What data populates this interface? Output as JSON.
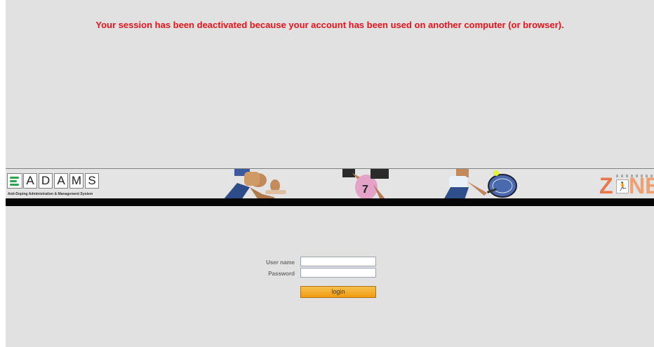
{
  "alert": {
    "message": "Your session has been deactivated because your account has been used on another computer (or browser)."
  },
  "banner": {
    "logo": {
      "letters": [
        "A",
        "D",
        "A",
        "M",
        "S"
      ],
      "tagline": "Anti-Doping Administration & Management System"
    },
    "zone_logo": "ZONE",
    "athlete_images": [
      "sprinter-icon",
      "runner-icon",
      "tennis-player-icon"
    ]
  },
  "login": {
    "username_label": "User name",
    "username_value": "",
    "password_label": "Password",
    "password_value": "",
    "login_button": "login"
  },
  "colors": {
    "page_bg": "#e1e1e1",
    "alert_red": "#e8141c",
    "button_orange": "#f09a10",
    "banner_bar": "#050505"
  }
}
